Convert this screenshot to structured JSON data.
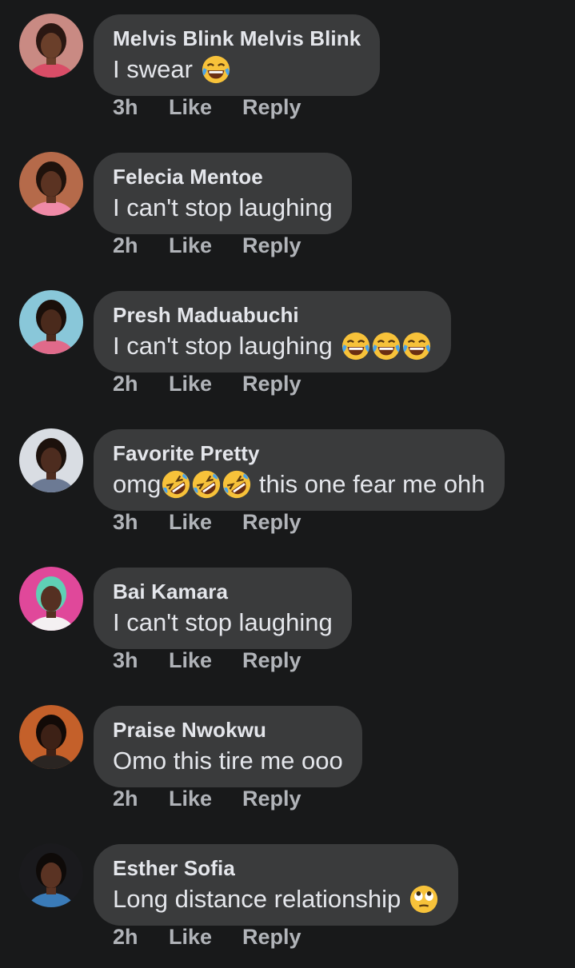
{
  "comments": [
    {
      "author": "Melvis Blink Melvis Blink",
      "parts": [
        {
          "t": "text",
          "v": "I swear"
        },
        {
          "t": "emoji",
          "v": "joy"
        }
      ],
      "time": "3h",
      "like_label": "Like",
      "reply_label": "Reply",
      "avatar": {
        "bg": "#c98a83",
        "skin": "#6a3f2a",
        "hair": "#2a1712",
        "cloth": "#d94d67"
      }
    },
    {
      "author": "Felecia Mentoe",
      "parts": [
        {
          "t": "text",
          "v": "I can't stop laughing"
        }
      ],
      "time": "2h",
      "like_label": "Like",
      "reply_label": "Reply",
      "avatar": {
        "bg": "#b56a4a",
        "skin": "#5b3322",
        "hair": "#1f120c",
        "cloth": "#ef8aa7"
      }
    },
    {
      "author": "Presh Maduabuchi",
      "parts": [
        {
          "t": "text",
          "v": "I can't stop laughing"
        },
        {
          "t": "emoji",
          "v": "joy"
        },
        {
          "t": "emoji",
          "v": "joy"
        },
        {
          "t": "emoji",
          "v": "joy"
        }
      ],
      "time": "2h",
      "like_label": "Like",
      "reply_label": "Reply",
      "avatar": {
        "bg": "#89c7d9",
        "skin": "#4a2a1c",
        "hair": "#1a0f0a",
        "cloth": "#e06a8a"
      }
    },
    {
      "author": "Favorite Pretty",
      "parts": [
        {
          "t": "text",
          "v": "omg"
        },
        {
          "t": "emoji",
          "v": "rofl"
        },
        {
          "t": "emoji",
          "v": "rofl"
        },
        {
          "t": "emoji",
          "v": "rofl"
        },
        {
          "t": "text",
          "v": " this one fear me ohh"
        }
      ],
      "time": "3h",
      "like_label": "Like",
      "reply_label": "Reply",
      "avatar": {
        "bg": "#d9dde3",
        "skin": "#4d2c1f",
        "hair": "#1c110c",
        "cloth": "#6c7a94"
      }
    },
    {
      "author": "Bai Kamara",
      "parts": [
        {
          "t": "text",
          "v": "I can't stop laughing"
        }
      ],
      "time": "3h",
      "like_label": "Like",
      "reply_label": "Reply",
      "avatar": {
        "bg": "#e0489a",
        "skin": "#553022",
        "hair": "#5fd0b5",
        "cloth": "#f4f0f2"
      }
    },
    {
      "author": "Praise Nwokwu",
      "parts": [
        {
          "t": "text",
          "v": "Omo this tire me ooo"
        }
      ],
      "time": "2h",
      "like_label": "Like",
      "reply_label": "Reply",
      "avatar": {
        "bg": "#c4602a",
        "skin": "#3d2116",
        "hair": "#120a07",
        "cloth": "#2a2522"
      }
    },
    {
      "author": "Esther Sofia",
      "parts": [
        {
          "t": "text",
          "v": "Long distance relationship"
        },
        {
          "t": "emoji",
          "v": "eye-roll"
        }
      ],
      "time": "2h",
      "like_label": "Like",
      "reply_label": "Reply",
      "avatar": {
        "bg": "#1a1a1d",
        "skin": "#5a3323",
        "hair": "#0e0a08",
        "cloth": "#3a7bb8"
      }
    }
  ]
}
